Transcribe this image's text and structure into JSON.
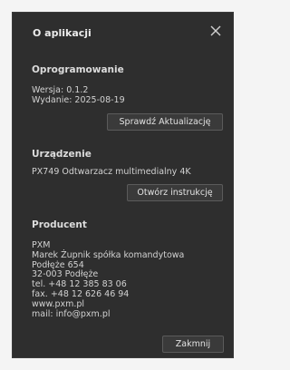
{
  "dialog": {
    "title": "O aplikacji",
    "close_label": "×"
  },
  "software": {
    "heading": "Oprogramowanie",
    "version": "Wersja: 0.1.2",
    "release": "Wydanie: 2025-08-19",
    "update_button": "Sprawdź Aktualizację"
  },
  "device": {
    "heading": "Urządzenie",
    "name": "PX749 Odtwarzacz multimedialny 4K",
    "manual_button": "Otwórz instrukcję"
  },
  "producer": {
    "heading": "Producent",
    "lines": [
      "PXM",
      "Marek Żupnik spółka komandytowa",
      "Podłęże 654",
      "32-003 Podłęże",
      "tel. +48 12 385 83 06",
      "fax. +48 12 626 46 94",
      "www.pxm.pl",
      "mail: info@pxm.pl"
    ]
  },
  "footer": {
    "close_button": "Zakmnij"
  },
  "colors": {
    "dialog_bg": "#2e2e2e",
    "button_bg": "#3a3a3a",
    "text": "#d2d2d2"
  }
}
